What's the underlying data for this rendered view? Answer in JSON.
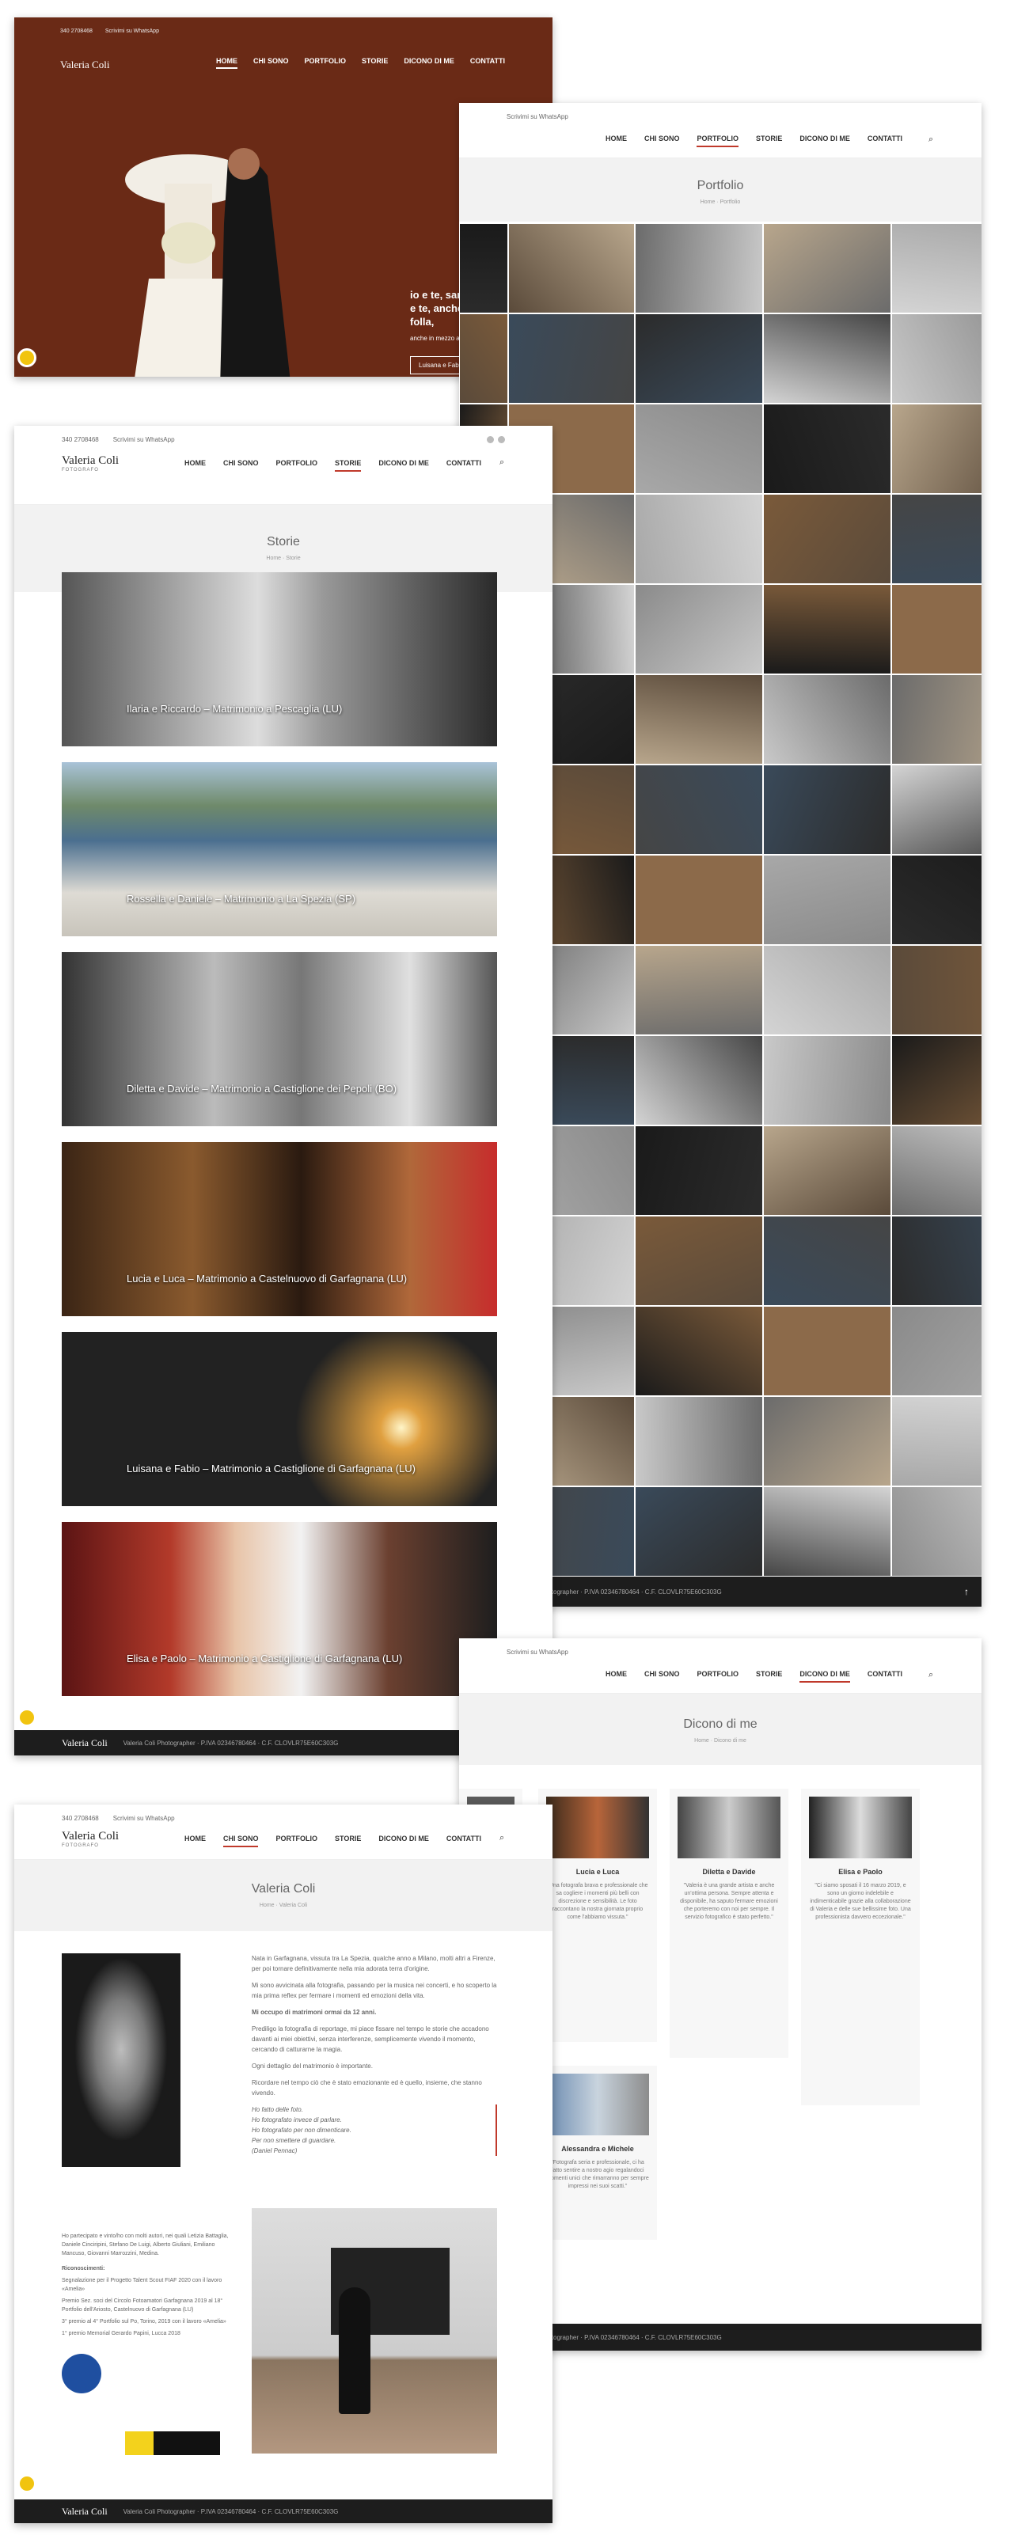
{
  "topbar": {
    "phone": "340 2708468",
    "whatsapp": "Scrivimi su WhatsApp"
  },
  "logo": {
    "name": "Valeria Coli",
    "sub": "FOTOGRAFO"
  },
  "nav": [
    "HOME",
    "CHI SONO",
    "PORTFOLIO",
    "STORIE",
    "DICONO DI ME",
    "CONTATTI"
  ],
  "hero": {
    "quote": "io e te, saremo sempre io e te, anche in mezzo alla folla,",
    "sub": "anche in mezzo al mondo, saremo io e te.",
    "button": "Luisana e Fabio"
  },
  "portfolio": {
    "title": "Portfolio",
    "crumb": "Home · Portfolio"
  },
  "storie": {
    "title": "Storie",
    "crumb": "Home · Storie",
    "items": [
      "Ilaria e Riccardo – Matrimonio a Pescaglia (LU)",
      "Rossella e Daniele – Matrimonio a La Spezia (SP)",
      "Diletta e Davide – Matrimonio a Castiglione dei Pepoli (BO)",
      "Lucia e Luca – Matrimonio a Castelnuovo di Garfagnana (LU)",
      "Luisana e Fabio – Matrimonio a Castiglione di Garfagnana (LU)",
      "Elisa e Paolo – Matrimonio a Castiglione di Garfagnana (LU)"
    ]
  },
  "dicono": {
    "title": "Dicono di me",
    "crumb": "Home · Dicono di me",
    "cards": [
      {
        "name": "Lucia e Luca",
        "text": "\"Una fotografa brava e professionale che sa cogliere i momenti più belli con discrezione e sensibilità. Le foto raccontano la nostra giornata proprio come l'abbiamo vissuta.\""
      },
      {
        "name": "Diletta e Davide",
        "text": "\"Valeria è una grande artista e anche un'ottima persona. Sempre attenta e disponibile, ha saputo fermare emozioni che porteremo con noi per sempre. Il servizio fotografico è stato perfetto.\""
      },
      {
        "name": "Elisa e Paolo",
        "text": "\"Ci siamo sposati il 16 marzo 2019, e sono un giorno indelebile e indimenticabile grazie alla collaborazione di Valeria e delle sue bellissime foto. Una professionista davvero eccezionale.\""
      },
      {
        "name": "Alessandra e Michele",
        "text": "\"Fotografa seria e professionale, ci ha fatto sentire a nostro agio regalandoci momenti unici che rimarranno per sempre impressi nei suoi scatti.\""
      }
    ]
  },
  "chisono": {
    "title": "Valeria Coli",
    "crumb": "Home · Valeria Coli",
    "paragraphs": [
      "Nata in Garfagnana, vissuta tra La Spezia, qualche anno a Milano, molti altri a Firenze, per poi tornare definitivamente nella mia adorata terra d'origine.",
      "Mi sono avvicinata alla fotografia, passando per la musica nei concerti, e ho scoperto la mia prima reflex per fermare i momenti ed emozioni della vita.",
      "Mi occupo di matrimoni ormai da 12 anni.",
      "Prediligo la fotografia di reportage, mi piace fissare nel tempo le storie che accadono davanti ai miei obiettivi, senza interferenze, semplicemente vivendo il momento, cercando di catturarne la magia.",
      "Ogni dettaglio del matrimonio è importante.",
      "Ricordare nel tempo ciò che è stato emozionante ed è quello, insieme, che stanno vivendo."
    ],
    "poem": [
      "Ho fatto delle foto.",
      "Ho fotografato invece di parlare.",
      "Ho fotografato per non dimenticare.",
      "Per non smettere di guardare.",
      "(Daniel Pennac)"
    ],
    "awards_intro": "Ho partecipato e vinto/ho con molti autori, nei quali Letizia Battaglia, Daniele Cinciripini, Stefano De Luigi, Alberto Giuliani, Emiliano Mancuso, Giovanni Marrozzini, Medina.",
    "awards_title": "Riconoscimenti:",
    "awards": [
      "Segnalazione per il Progetto Talent Scout FIAF 2020 con il lavoro «Amelia»",
      "Premio Sez. soci del Circolo Fotoamatori Garfagnana 2019 al 18° Portfolio dell'Ariosto, Castelnuovo di Garfagnana (LU)",
      "3° premio al 4° Portfolio sul Po, Torino, 2019 con il lavoro «Amelia»",
      "1° premio Memorial Gerardo Papini, Lucca 2018"
    ]
  },
  "footer": "Valeria Coli Photographer · P.IVA 02346780464 · C.F. CLOVLR75E60C303G",
  "colors": {
    "accent": "#c0392b",
    "hero": "#6a2a16",
    "footer": "#1d1d1d"
  }
}
